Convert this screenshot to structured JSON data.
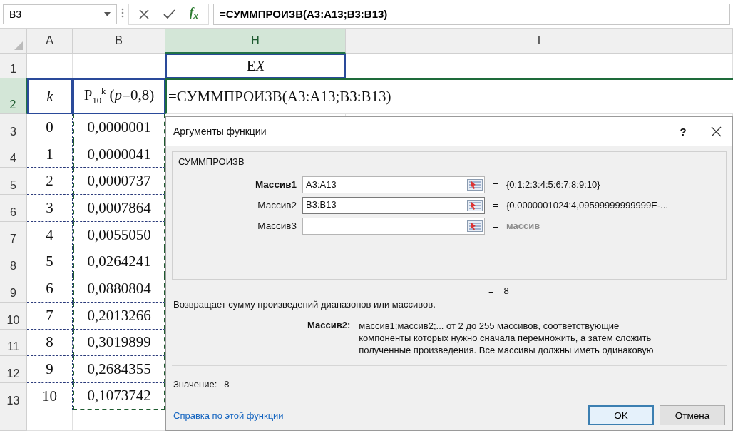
{
  "formula_bar": {
    "name_box": "B3",
    "fx": "f$_{x}$",
    "formula": "=СУММПРОИЗВ(A3:A13;B3:B13)"
  },
  "columns": [
    {
      "label": "A",
      "selected": false
    },
    {
      "label": "B",
      "selected": false
    },
    {
      "label": "H",
      "selected": true
    },
    {
      "label": "I",
      "selected": false
    }
  ],
  "rows": [
    {
      "header": "1",
      "selected": false,
      "kind": "plain",
      "cells": {
        "h": [
          {
            "text": "E",
            "italic": false
          },
          {
            "text": "X",
            "italic": true
          }
        ]
      }
    },
    {
      "header": "2",
      "selected": true,
      "kind": "label",
      "cells": {
        "a": "k",
        "b": "P$_{10}$$^{k}$ (*p*=0,8)",
        "h": "=СУММПРОИЗВ(A3:A13;B3:B13)"
      }
    },
    {
      "header": "3",
      "selected": false,
      "kind": "data",
      "cells": {
        "a": "0",
        "b": "0,0000001"
      }
    },
    {
      "header": "4",
      "selected": false,
      "kind": "data",
      "cells": {
        "a": "1",
        "b": "0,0000041"
      }
    },
    {
      "header": "5",
      "selected": false,
      "kind": "data",
      "cells": {
        "a": "2",
        "b": "0,0000737"
      }
    },
    {
      "header": "6",
      "selected": false,
      "kind": "data",
      "cells": {
        "a": "3",
        "b": "0,0007864"
      }
    },
    {
      "header": "7",
      "selected": false,
      "kind": "data",
      "cells": {
        "a": "4",
        "b": "0,0055050"
      }
    },
    {
      "header": "8",
      "selected": false,
      "kind": "data",
      "cells": {
        "a": "5",
        "b": "0,0264241"
      }
    },
    {
      "header": "9",
      "selected": false,
      "kind": "data",
      "cells": {
        "a": "6",
        "b": "0,0880804"
      }
    },
    {
      "header": "10",
      "selected": false,
      "kind": "data",
      "cells": {
        "a": "7",
        "b": "0,2013266"
      }
    },
    {
      "header": "11",
      "selected": false,
      "kind": "data",
      "cells": {
        "a": "8",
        "b": "0,3019899"
      }
    },
    {
      "header": "12",
      "selected": false,
      "kind": "data",
      "cells": {
        "a": "9",
        "b": "0,2684355"
      }
    },
    {
      "header": "13",
      "selected": false,
      "kind": "data",
      "cells": {
        "a": "10",
        "b": "0,1073742"
      }
    }
  ],
  "dialog": {
    "title": "Аргументы функции",
    "help_button": "?",
    "function_name": "СУММПРОИЗВ",
    "arguments": [
      {
        "label": "Массив1",
        "required": true,
        "focused": false,
        "value": "A3:A13",
        "equals": "=",
        "result": "{0:1:2:3:4:5:6:7:8:9:10}",
        "greyed": false
      },
      {
        "label": "Массив2",
        "required": false,
        "focused": true,
        "value": "B3:B13",
        "equals": "=",
        "result": "{0,0000001024:4,09599999999999E-...",
        "greyed": false
      },
      {
        "label": "Массив3",
        "required": false,
        "focused": false,
        "equals": "=",
        "result": "массив",
        "greyed": true
      }
    ],
    "formula_result": {
      "equals": "=",
      "value": "8"
    },
    "description": "Возвращает сумму произведений диапазонов или массивов.",
    "argument_help": {
      "label": "Массив2:",
      "text": "массив1;массив2;... от 2 до 255 массивов, соответствующие компоненты которых нужно сначала перемножить, а затем сложить полученные произведения. Все массивы должны иметь одинаковую"
    },
    "value_line": {
      "label": "Значение:",
      "value": "8"
    },
    "help_link": "Справка по этой функции",
    "buttons": [
      {
        "label": "OK",
        "default": true
      },
      {
        "label": "Отмена",
        "default": false
      }
    ]
  }
}
